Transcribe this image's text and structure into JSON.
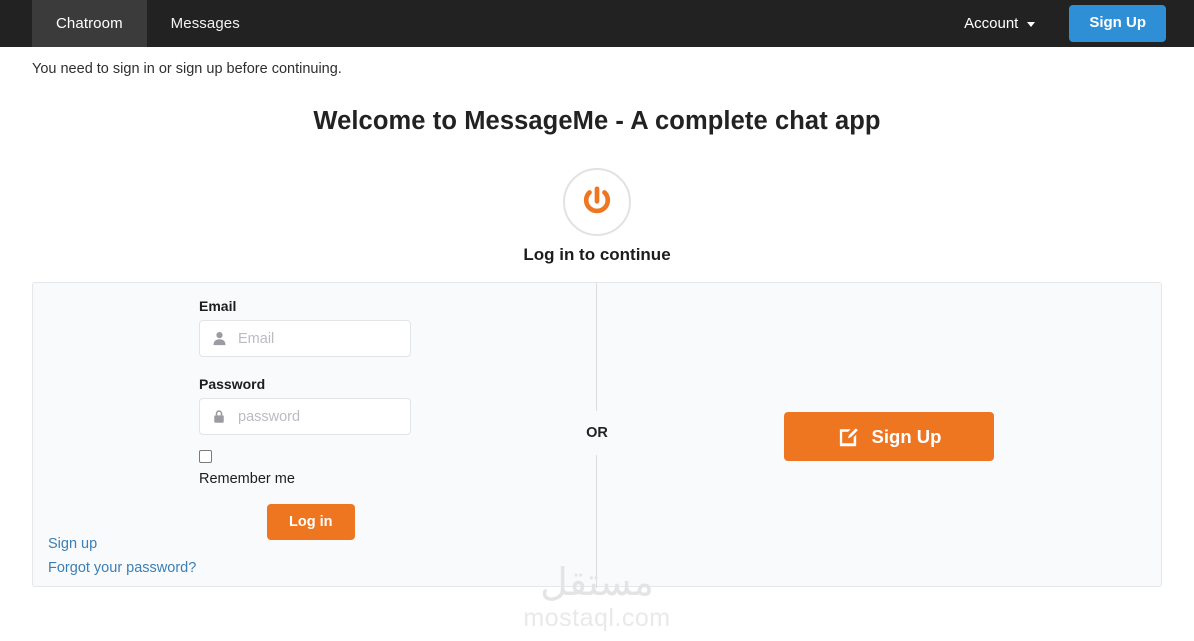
{
  "navbar": {
    "tabs": [
      {
        "label": "Chatroom",
        "active": true
      },
      {
        "label": "Messages",
        "active": false
      }
    ],
    "account_label": "Account",
    "signup_label": "Sign Up",
    "signup_color": "#2e8fd6",
    "background_color": "#222222"
  },
  "flash": {
    "message": "You need to sign in or sign up before continuing."
  },
  "hero": {
    "title": "Welcome to MessageMe - A complete chat app",
    "icon": "power-icon",
    "icon_color": "#ef7621",
    "subtitle": "Log in to continue"
  },
  "panel": {
    "divider_label": "OR",
    "form": {
      "email_label": "Email",
      "email_value": "",
      "email_placeholder": "Email",
      "email_icon": "user-icon",
      "password_label": "Password",
      "password_value": "",
      "password_placeholder": "password",
      "password_icon": "lock-icon",
      "remember_label": "Remember me",
      "remember_checked": false,
      "login_label": "Log in",
      "login_color": "#ef7621"
    },
    "links": [
      {
        "label": "Sign up"
      },
      {
        "label": "Forgot your password?"
      }
    ],
    "link_color": "#3b7fb5",
    "signup_cta": {
      "label": "Sign Up",
      "icon": "edit-square-icon",
      "color": "#ef7621"
    }
  },
  "watermark": {
    "arabic": "مستقل",
    "latin": "mostaql.com"
  }
}
